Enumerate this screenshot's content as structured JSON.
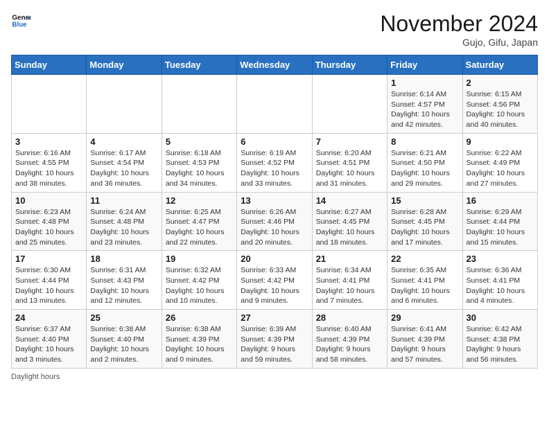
{
  "header": {
    "logo_line1": "General",
    "logo_line2": "Blue",
    "month_title": "November 2024",
    "location": "Gujo, Gifu, Japan"
  },
  "columns": [
    "Sunday",
    "Monday",
    "Tuesday",
    "Wednesday",
    "Thursday",
    "Friday",
    "Saturday"
  ],
  "weeks": [
    [
      {
        "day": "",
        "info": ""
      },
      {
        "day": "",
        "info": ""
      },
      {
        "day": "",
        "info": ""
      },
      {
        "day": "",
        "info": ""
      },
      {
        "day": "",
        "info": ""
      },
      {
        "day": "1",
        "info": "Sunrise: 6:14 AM\nSunset: 4:57 PM\nDaylight: 10 hours and 42 minutes."
      },
      {
        "day": "2",
        "info": "Sunrise: 6:15 AM\nSunset: 4:56 PM\nDaylight: 10 hours and 40 minutes."
      }
    ],
    [
      {
        "day": "3",
        "info": "Sunrise: 6:16 AM\nSunset: 4:55 PM\nDaylight: 10 hours and 38 minutes."
      },
      {
        "day": "4",
        "info": "Sunrise: 6:17 AM\nSunset: 4:54 PM\nDaylight: 10 hours and 36 minutes."
      },
      {
        "day": "5",
        "info": "Sunrise: 6:18 AM\nSunset: 4:53 PM\nDaylight: 10 hours and 34 minutes."
      },
      {
        "day": "6",
        "info": "Sunrise: 6:19 AM\nSunset: 4:52 PM\nDaylight: 10 hours and 33 minutes."
      },
      {
        "day": "7",
        "info": "Sunrise: 6:20 AM\nSunset: 4:51 PM\nDaylight: 10 hours and 31 minutes."
      },
      {
        "day": "8",
        "info": "Sunrise: 6:21 AM\nSunset: 4:50 PM\nDaylight: 10 hours and 29 minutes."
      },
      {
        "day": "9",
        "info": "Sunrise: 6:22 AM\nSunset: 4:49 PM\nDaylight: 10 hours and 27 minutes."
      }
    ],
    [
      {
        "day": "10",
        "info": "Sunrise: 6:23 AM\nSunset: 4:48 PM\nDaylight: 10 hours and 25 minutes."
      },
      {
        "day": "11",
        "info": "Sunrise: 6:24 AM\nSunset: 4:48 PM\nDaylight: 10 hours and 23 minutes."
      },
      {
        "day": "12",
        "info": "Sunrise: 6:25 AM\nSunset: 4:47 PM\nDaylight: 10 hours and 22 minutes."
      },
      {
        "day": "13",
        "info": "Sunrise: 6:26 AM\nSunset: 4:46 PM\nDaylight: 10 hours and 20 minutes."
      },
      {
        "day": "14",
        "info": "Sunrise: 6:27 AM\nSunset: 4:45 PM\nDaylight: 10 hours and 18 minutes."
      },
      {
        "day": "15",
        "info": "Sunrise: 6:28 AM\nSunset: 4:45 PM\nDaylight: 10 hours and 17 minutes."
      },
      {
        "day": "16",
        "info": "Sunrise: 6:29 AM\nSunset: 4:44 PM\nDaylight: 10 hours and 15 minutes."
      }
    ],
    [
      {
        "day": "17",
        "info": "Sunrise: 6:30 AM\nSunset: 4:44 PM\nDaylight: 10 hours and 13 minutes."
      },
      {
        "day": "18",
        "info": "Sunrise: 6:31 AM\nSunset: 4:43 PM\nDaylight: 10 hours and 12 minutes."
      },
      {
        "day": "19",
        "info": "Sunrise: 6:32 AM\nSunset: 4:42 PM\nDaylight: 10 hours and 10 minutes."
      },
      {
        "day": "20",
        "info": "Sunrise: 6:33 AM\nSunset: 4:42 PM\nDaylight: 10 hours and 9 minutes."
      },
      {
        "day": "21",
        "info": "Sunrise: 6:34 AM\nSunset: 4:41 PM\nDaylight: 10 hours and 7 minutes."
      },
      {
        "day": "22",
        "info": "Sunrise: 6:35 AM\nSunset: 4:41 PM\nDaylight: 10 hours and 6 minutes."
      },
      {
        "day": "23",
        "info": "Sunrise: 6:36 AM\nSunset: 4:41 PM\nDaylight: 10 hours and 4 minutes."
      }
    ],
    [
      {
        "day": "24",
        "info": "Sunrise: 6:37 AM\nSunset: 4:40 PM\nDaylight: 10 hours and 3 minutes."
      },
      {
        "day": "25",
        "info": "Sunrise: 6:38 AM\nSunset: 4:40 PM\nDaylight: 10 hours and 2 minutes."
      },
      {
        "day": "26",
        "info": "Sunrise: 6:38 AM\nSunset: 4:39 PM\nDaylight: 10 hours and 0 minutes."
      },
      {
        "day": "27",
        "info": "Sunrise: 6:39 AM\nSunset: 4:39 PM\nDaylight: 9 hours and 59 minutes."
      },
      {
        "day": "28",
        "info": "Sunrise: 6:40 AM\nSunset: 4:39 PM\nDaylight: 9 hours and 58 minutes."
      },
      {
        "day": "29",
        "info": "Sunrise: 6:41 AM\nSunset: 4:39 PM\nDaylight: 9 hours and 57 minutes."
      },
      {
        "day": "30",
        "info": "Sunrise: 6:42 AM\nSunset: 4:38 PM\nDaylight: 9 hours and 56 minutes."
      }
    ]
  ],
  "footer": {
    "note": "Daylight hours"
  }
}
